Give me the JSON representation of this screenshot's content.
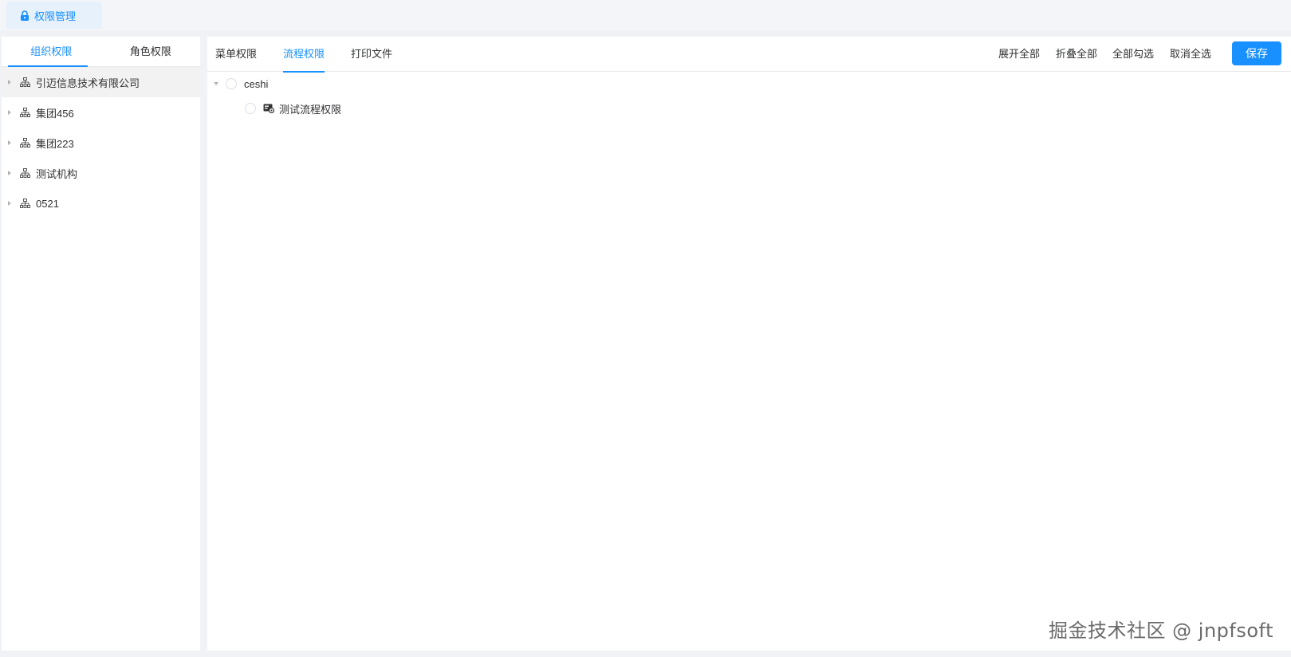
{
  "top_tab": {
    "label": "权限管理",
    "icon": "lock-icon"
  },
  "left_tabs": [
    {
      "label": "组织权限",
      "active": true
    },
    {
      "label": "角色权限",
      "active": false
    }
  ],
  "org_tree": [
    {
      "label": "引迈信息技术有限公司",
      "icon": "org-chart-icon",
      "selected": true
    },
    {
      "label": "集团456",
      "icon": "org-chart-icon"
    },
    {
      "label": "集团223",
      "icon": "org-chart-icon"
    },
    {
      "label": "测试机构",
      "icon": "org-chart-icon"
    },
    {
      "label": "0521",
      "icon": "org-chart-icon"
    }
  ],
  "right_tabs": [
    {
      "label": "菜单权限",
      "active": false
    },
    {
      "label": "流程权限",
      "active": true
    },
    {
      "label": "打印文件",
      "active": false
    }
  ],
  "actions": {
    "expand_all": "展开全部",
    "collapse_all": "折叠全部",
    "select_all": "全部勾选",
    "deselect_all": "取消全选",
    "save": "保存"
  },
  "flow_tree": {
    "root": {
      "label": "ceshi",
      "expanded": true
    },
    "children": [
      {
        "label": "测试流程权限",
        "icon": "flow-icon"
      }
    ]
  },
  "watermark": "掘金技术社区 @ jnpfsoft",
  "colors": {
    "accent": "#1890ff",
    "tab_bg": "#e6f1fc",
    "page_bg": "#f0f2f5"
  }
}
